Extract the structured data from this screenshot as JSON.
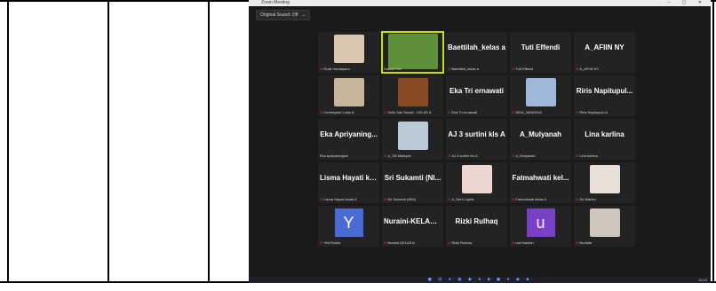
{
  "zoom": {
    "window_title": "Zoom Meeting",
    "view_button": "Original Sound: Off",
    "participants": [
      {
        "name": "",
        "label": "Rusli Handayani",
        "kind": "photo",
        "color": "#d9c7b0",
        "muted": true
      },
      {
        "name": "",
        "label": "Zakiah Fitri",
        "kind": "photo-wide",
        "color": "#5e8f3a",
        "muted": false,
        "active": true
      },
      {
        "name": "Baettilah_kelas a",
        "label": "Baettilah_kelas a",
        "kind": "text",
        "muted": true
      },
      {
        "name": "Tuti Effendi",
        "label": "Tuti Effendi",
        "kind": "text",
        "muted": true
      },
      {
        "name": "A_AFIIN NY",
        "label": "A_AFIIN NY",
        "kind": "text",
        "muted": true
      },
      {
        "name": "",
        "label": "Cemeiyanti Lubis A",
        "kind": "photo",
        "color": "#c7b59b",
        "muted": true
      },
      {
        "name": "",
        "label": "Sulis Sari Sukati - KELAS A",
        "kind": "photo",
        "color": "#8a4a25",
        "muted": true
      },
      {
        "name": "Eka Tri ernawati",
        "label": "Eka Tri ernawati",
        "kind": "text",
        "muted": true
      },
      {
        "name": "",
        "label": "AIDA_NANDINA",
        "kind": "photo",
        "color": "#9fb6d8",
        "muted": true
      },
      {
        "name": "Riris Napitupul...",
        "label": "Riris Napitupulu A",
        "kind": "text",
        "muted": true
      },
      {
        "name": "Eka Apriyaning...",
        "label": "Eka Apriyaningsih",
        "kind": "text",
        "muted": false
      },
      {
        "name": "",
        "label": "A_Siti Maisyah",
        "kind": "photo",
        "color": "#b9c9d6",
        "muted": true
      },
      {
        "name": "AJ 3 surtini kls A",
        "label": "AJ 3 surtini kls A",
        "kind": "text",
        "muted": true
      },
      {
        "name": "A_Mulyanah",
        "label": "A_Mulyanah",
        "kind": "text",
        "muted": true
      },
      {
        "name": "Lina karlina",
        "label": "Lina karlina",
        "kind": "text",
        "muted": true
      },
      {
        "name": "Lisma Hayati ke...",
        "label": "Lisma Hayati kelas A",
        "kind": "text",
        "muted": true
      },
      {
        "name": "Sri Sukamti (Nl...",
        "label": "Sri Sukamti (NIM)",
        "kind": "text",
        "muted": true
      },
      {
        "name": "",
        "label": "A_Reni Lupita",
        "kind": "photo",
        "color": "#ecd6d0",
        "muted": true
      },
      {
        "name": "Fatmahwati kel...",
        "label": "Fatmahwati kelas A",
        "kind": "text",
        "muted": true
      },
      {
        "name": "",
        "label": "Sri Wartini",
        "kind": "photo",
        "color": "#e8e0d6",
        "muted": true
      },
      {
        "name": "",
        "label": "Yeti Rosita",
        "kind": "letter",
        "letter": "Y",
        "color": "#4a6bd6",
        "muted": true
      },
      {
        "name": "Nuraini-KELAS A",
        "label": "Nuraini-KELAS A",
        "kind": "text",
        "muted": true
      },
      {
        "name": "Rizki Rulhaq",
        "label": "Rizki Rulhaq",
        "kind": "text",
        "muted": true
      },
      {
        "name": "",
        "label": "umi Nadiah",
        "kind": "letter",
        "letter": "u",
        "color": "#7a3fc7",
        "muted": true
      },
      {
        "name": "",
        "label": "Nurlaila",
        "kind": "photo",
        "color": "#cfc6bb",
        "muted": true
      }
    ]
  },
  "taskbar": {
    "icons": "◼ ⊞ ● ◉ ◆ ● ■ ◼ ● ◆ ■",
    "time": "10:15"
  }
}
